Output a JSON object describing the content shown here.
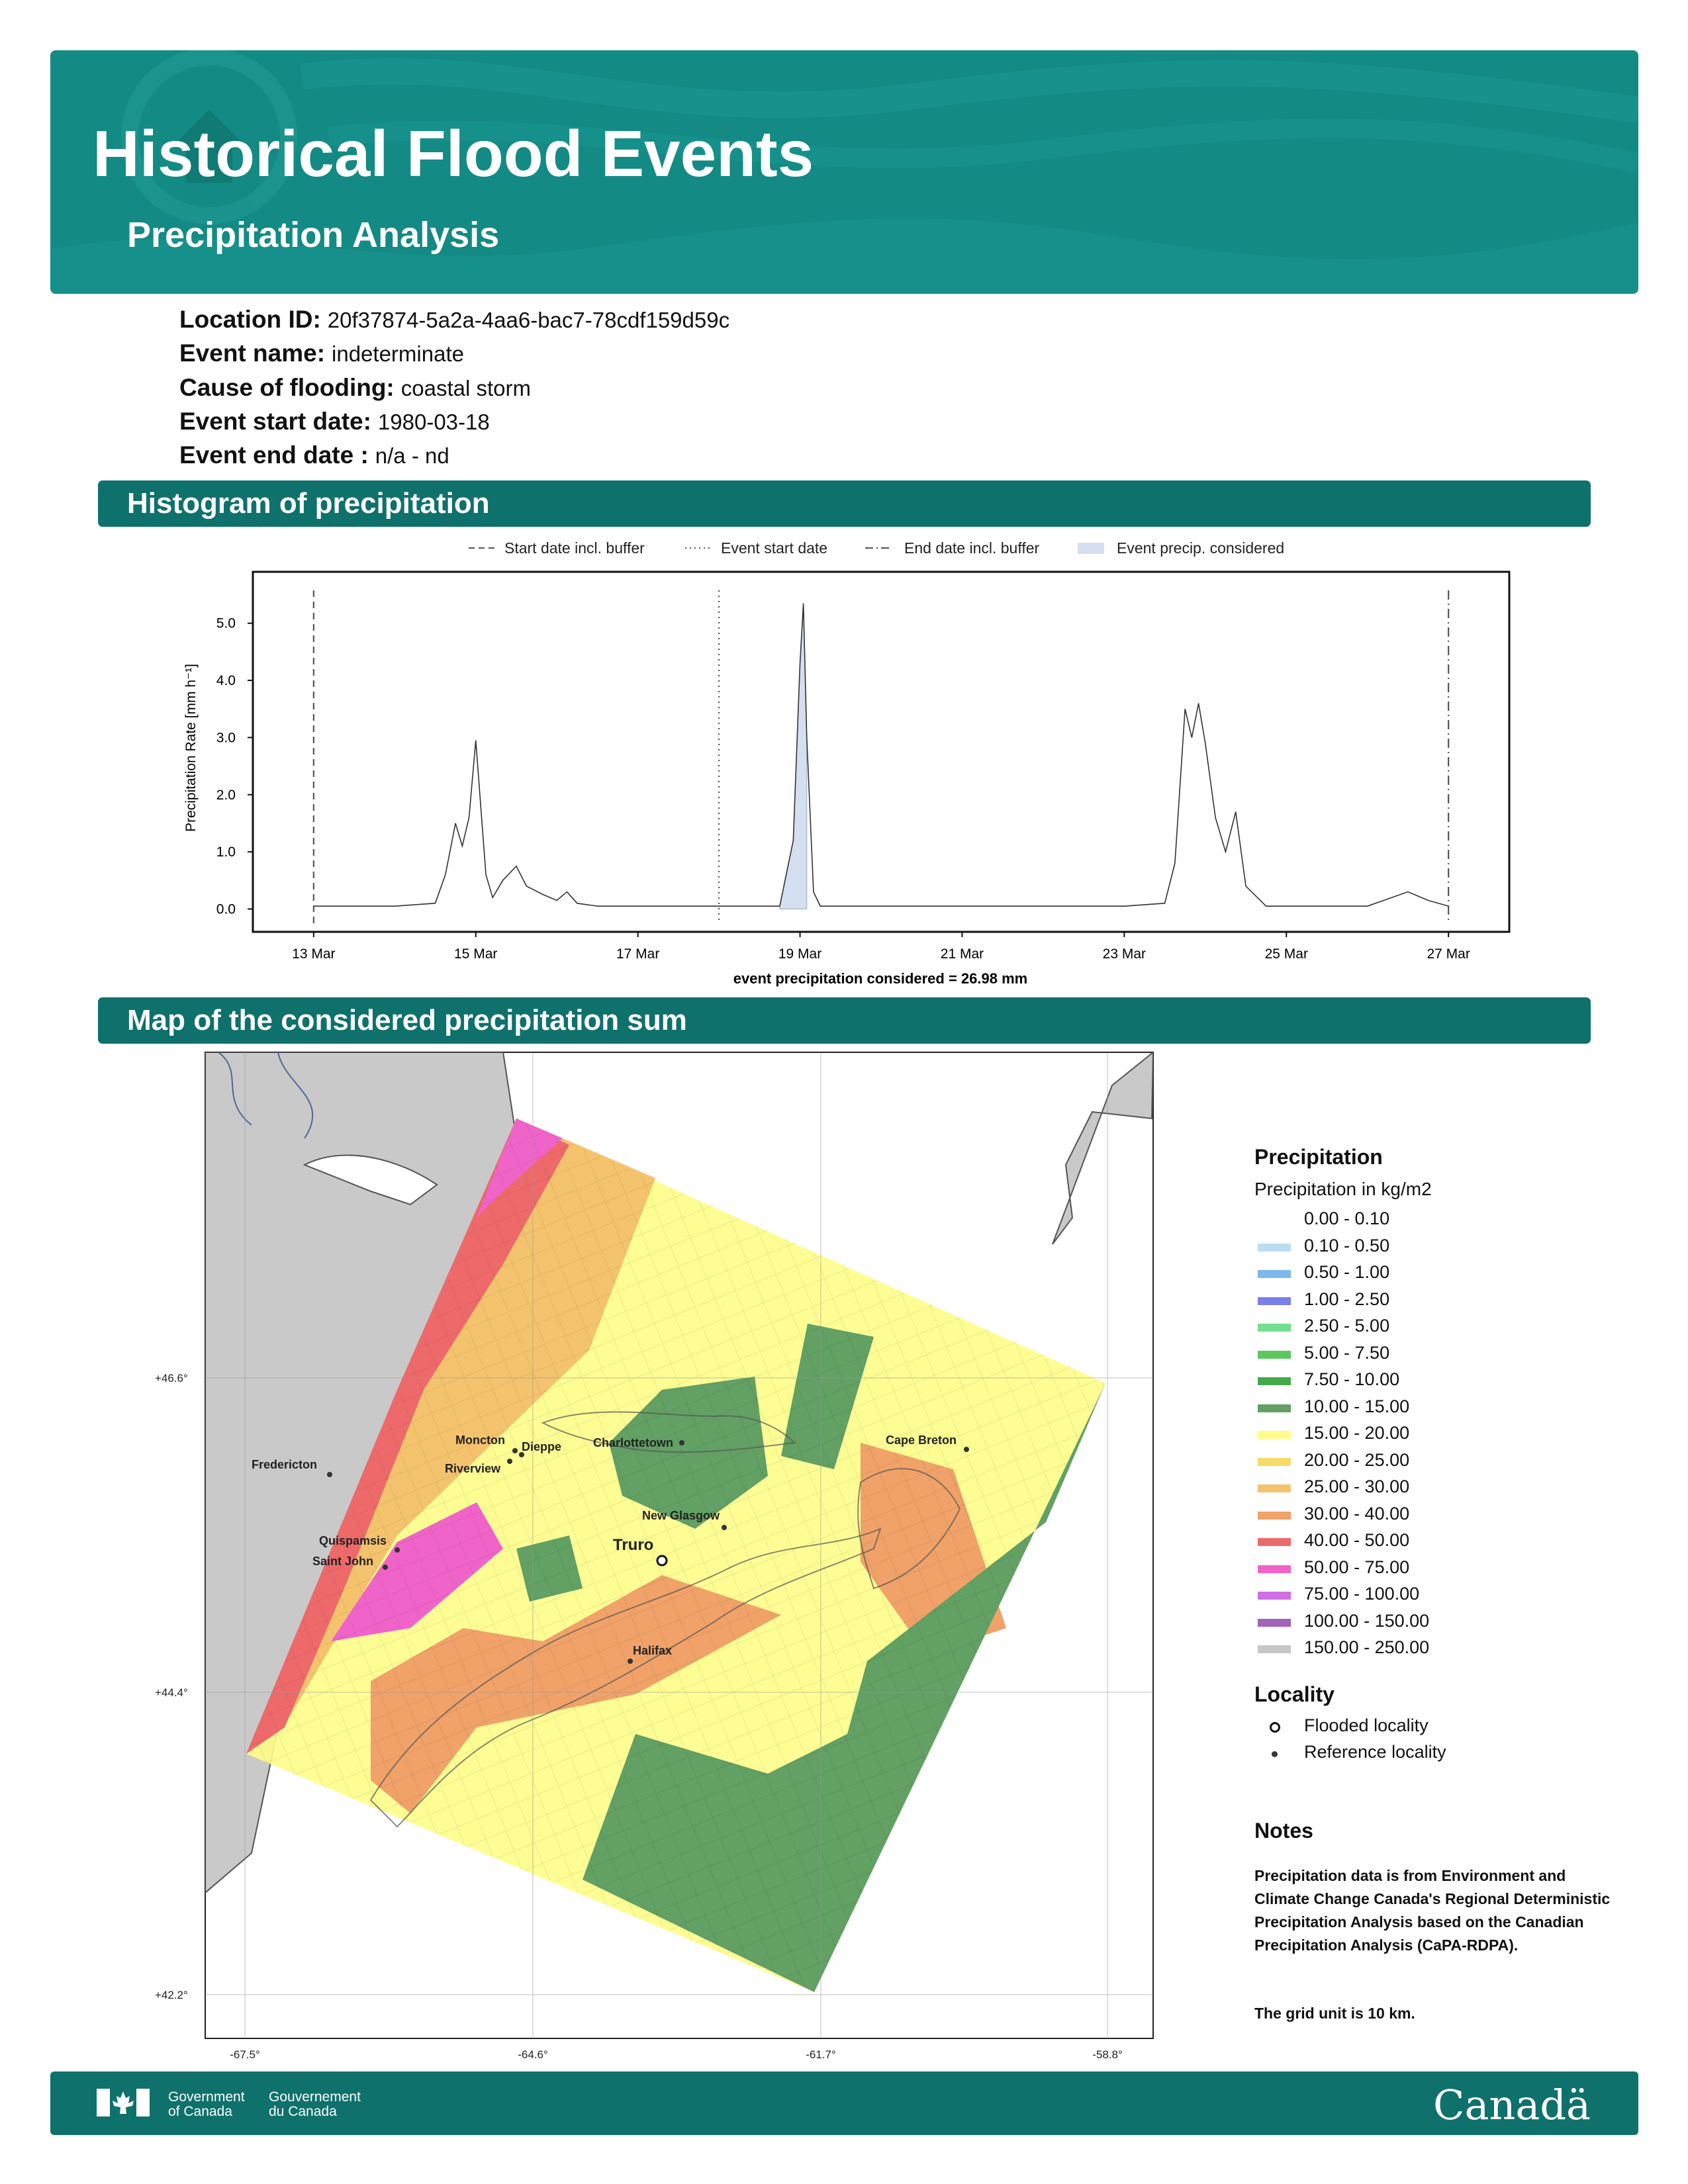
{
  "header": {
    "title": "Historical Flood Events",
    "subtitle": "Precipitation Analysis"
  },
  "info": [
    {
      "key": "Location ID:",
      "value": "20f37874-5a2a-4aa6-bac7-78cdf159d59c"
    },
    {
      "key": "Event name:",
      "value": "indeterminate"
    },
    {
      "key": "Cause of flooding:",
      "value": "coastal storm"
    },
    {
      "key": "Event start date:",
      "value": "1980-03-18"
    },
    {
      "key": "Event end date :",
      "value": "n/a - nd"
    }
  ],
  "sections": {
    "histogram": "Histogram of precipitation",
    "map": "Map of the considered precipitation sum"
  },
  "chart_data": {
    "type": "line",
    "ylabel": "Precipitation Rate [mm h⁻¹]",
    "xlabel": "event precipitation considered = 26.98 mm",
    "x_tick_labels": [
      "13 Mar",
      "15 Mar",
      "17 Mar",
      "19 Mar",
      "21 Mar",
      "23 Mar",
      "25 Mar",
      "27 Mar"
    ],
    "y_tick_labels": [
      "0.0",
      "1.0",
      "2.0",
      "3.0",
      "4.0",
      "5.0"
    ],
    "xlim": [
      "1980-03-12 06:00",
      "1980-03-27 18:00"
    ],
    "ylim": [
      -0.4,
      5.9
    ],
    "grid": false,
    "legend": [
      "Start date incl. buffer",
      "Event start date",
      "End date incl. buffer",
      "Event precip. considered"
    ],
    "legend_position": "top",
    "vlines": [
      {
        "x": "1980-03-13 00:00",
        "style": "dashed"
      },
      {
        "x": "1980-03-18 00:00",
        "style": "dotted"
      },
      {
        "x": "1980-03-27 00:00",
        "style": "dashdot"
      }
    ],
    "event_window": [
      "1980-03-18 18:00",
      "1980-03-19 03:00"
    ],
    "series": [
      {
        "x": [
          "1980-03-13 00:00",
          "1980-03-14 00:00",
          "1980-03-14 12:00",
          "1980-03-14 15:00",
          "1980-03-14 18:00",
          "1980-03-14 20:00",
          "1980-03-14 22:00",
          "1980-03-15 00:00",
          "1980-03-15 03:00",
          "1980-03-15 05:00",
          "1980-03-15 08:00",
          "1980-03-15 12:00",
          "1980-03-15 15:00",
          "1980-03-15 20:00",
          "1980-03-16 00:00",
          "1980-03-16 03:00",
          "1980-03-16 06:00",
          "1980-03-16 12:00",
          "1980-03-17 00:00",
          "1980-03-18 00:00",
          "1980-03-18 18:00",
          "1980-03-18 22:00",
          "1980-03-19 00:00",
          "1980-03-19 01:00",
          "1980-03-19 02:00",
          "1980-03-19 04:00",
          "1980-03-19 06:00",
          "1980-03-20 00:00",
          "1980-03-22 00:00",
          "1980-03-23 00:00",
          "1980-03-23 12:00",
          "1980-03-23 15:00",
          "1980-03-23 18:00",
          "1980-03-23 20:00",
          "1980-03-23 22:00",
          "1980-03-24 00:00",
          "1980-03-24 03:00",
          "1980-03-24 06:00",
          "1980-03-24 09:00",
          "1980-03-24 12:00",
          "1980-03-24 18:00",
          "1980-03-25 00:00",
          "1980-03-26 00:00",
          "1980-03-26 12:00",
          "1980-03-26 18:00",
          "1980-03-27 00:00"
        ],
        "y": [
          0.05,
          0.05,
          0.1,
          0.6,
          1.5,
          1.1,
          1.6,
          2.95,
          0.6,
          0.2,
          0.5,
          0.75,
          0.4,
          0.25,
          0.15,
          0.3,
          0.1,
          0.05,
          0.05,
          0.05,
          0.05,
          1.2,
          4.3,
          5.35,
          3.0,
          0.3,
          0.05,
          0.05,
          0.05,
          0.05,
          0.1,
          0.8,
          3.5,
          3.0,
          3.6,
          2.9,
          1.6,
          1.0,
          1.7,
          0.4,
          0.05,
          0.05,
          0.05,
          0.3,
          0.15,
          0.05
        ]
      }
    ]
  },
  "map": {
    "lat_labels": [
      "+46.6°",
      "+44.4°",
      "+42.2°"
    ],
    "lon_labels": [
      "-67.5°",
      "-64.6°",
      "-61.7°",
      "-58.8°"
    ],
    "places": [
      "Moncton",
      "Dieppe",
      "Riverview",
      "Charlottetown",
      "Cape Breton",
      "Fredericton",
      "New Glasgow",
      "Quispamsis",
      "Saint John",
      "Truro",
      "Halifax"
    ]
  },
  "legend": {
    "title": "Precipitation",
    "subtitle": "Precipitation in kg/m2",
    "classes": [
      {
        "label": "0.00 - 0.10",
        "color": "#ffffff"
      },
      {
        "label": "0.10 - 0.50",
        "color": "#bcdcf2"
      },
      {
        "label": "0.50 - 1.00",
        "color": "#7bb8ec"
      },
      {
        "label": "1.00 - 2.50",
        "color": "#7b7fe8"
      },
      {
        "label": "2.50 - 5.00",
        "color": "#74e08f"
      },
      {
        "label": "5.00 - 7.50",
        "color": "#5bc85e"
      },
      {
        "label": "7.50 - 10.00",
        "color": "#44a94a"
      },
      {
        "label": "10.00 - 15.00",
        "color": "#62a064"
      },
      {
        "label": "15.00 - 20.00",
        "color": "#fdfd88"
      },
      {
        "label": "20.00 - 25.00",
        "color": "#f6dc67"
      },
      {
        "label": "25.00 - 30.00",
        "color": "#f4c36d"
      },
      {
        "label": "30.00 - 40.00",
        "color": "#f0a269"
      },
      {
        "label": "40.00 - 50.00",
        "color": "#ee6a6a"
      },
      {
        "label": "50.00 - 75.00",
        "color": "#f064c9"
      },
      {
        "label": "75.00 - 100.00",
        "color": "#cd6fe0"
      },
      {
        "label": "100.00 - 150.00",
        "color": "#a064b8"
      },
      {
        "label": "150.00 - 250.00",
        "color": "#c6c6c6"
      }
    ],
    "locality_title": "Locality",
    "flooded": "Flooded locality",
    "reference": "Reference locality"
  },
  "notes": {
    "title": "Notes",
    "text1": "Precipitation data is from Environment and Climate Change Canada's Regional Deterministic Precipitation Analysis based on the Canadian Precipitation Analysis (CaPA-RDPA).",
    "text2": "The grid unit is 10 km."
  },
  "footer": {
    "gov_en_1": "Government",
    "gov_en_2": "of Canada",
    "gov_fr_1": "Gouvernement",
    "gov_fr_2": "du Canada",
    "wordmark": "Canadä"
  }
}
